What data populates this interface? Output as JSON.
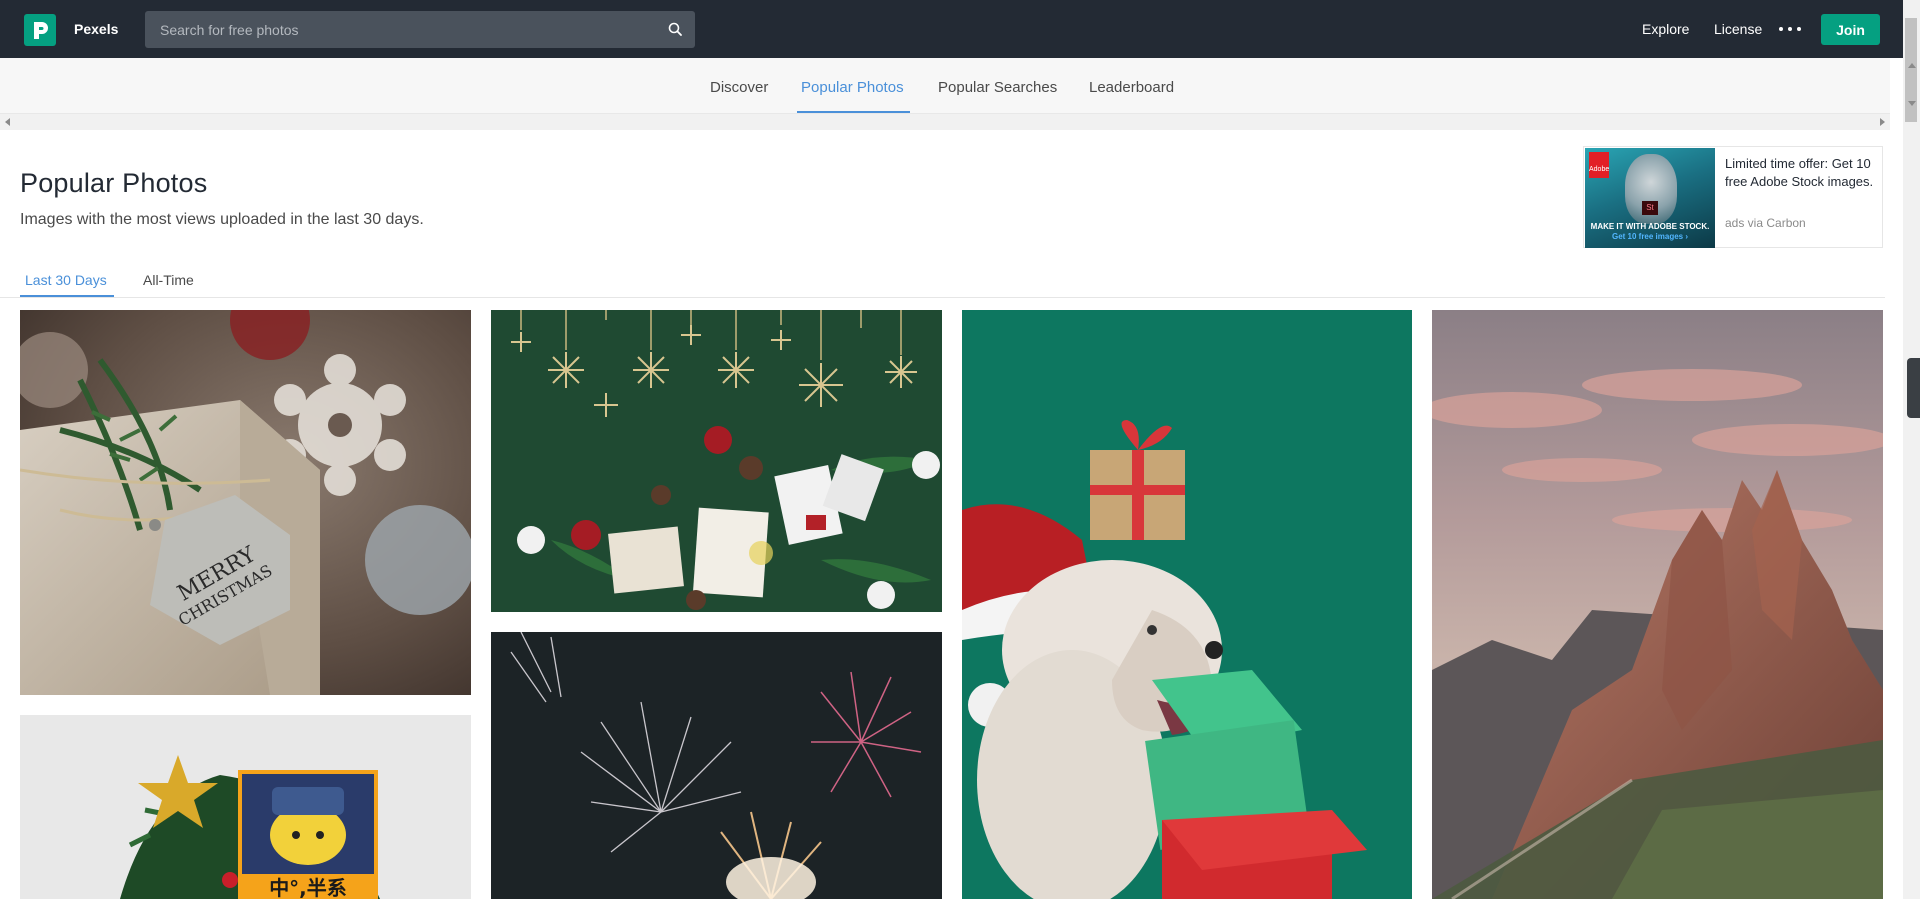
{
  "header": {
    "brand": "Pexels",
    "search": {
      "placeholder": "Search for free photos"
    },
    "nav": {
      "explore": "Explore",
      "license": "License"
    },
    "join_label": "Join"
  },
  "subnav": {
    "tabs": [
      {
        "label": "Discover",
        "active": false
      },
      {
        "label": "Popular Photos",
        "active": true
      },
      {
        "label": "Popular Searches",
        "active": false
      },
      {
        "label": "Leaderboard",
        "active": false
      }
    ]
  },
  "page": {
    "title": "Popular Photos",
    "subtitle": "Images with the most views uploaded in the last 30 days."
  },
  "ad": {
    "text": "Limited time offer: Get 10 free Adobe Stock images.",
    "via": "ads via Carbon",
    "image": {
      "logo_text": "Adobe",
      "product_mark": "St",
      "caption": "MAKE IT WITH ADOBE STOCK.",
      "cta": "Get 10 free images ›"
    }
  },
  "filters": {
    "tabs": [
      {
        "label": "Last 30 Days",
        "active": true
      },
      {
        "label": "All-Time",
        "active": false
      }
    ]
  },
  "photos": [
    {
      "subject": "christmas-gift-tag",
      "tag_line1": "MERRY",
      "tag_line2": "CHRISTMAS"
    },
    {
      "subject": "christmas-flatlay-green"
    },
    {
      "subject": "bulldog-santa-hat-gifts"
    },
    {
      "subject": "mountain-peaks-sunset"
    },
    {
      "subject": "christmas-tree-pikachu",
      "sign_text": "中°,半系"
    },
    {
      "subject": "fireworks-night"
    }
  ],
  "colors": {
    "topbar": "#232a34",
    "brand_green": "#05a081",
    "accent_blue": "#4a90d9"
  },
  "icons": {
    "logo": "pexels-logo-icon",
    "search": "search-icon",
    "more": "more-dots-icon"
  }
}
